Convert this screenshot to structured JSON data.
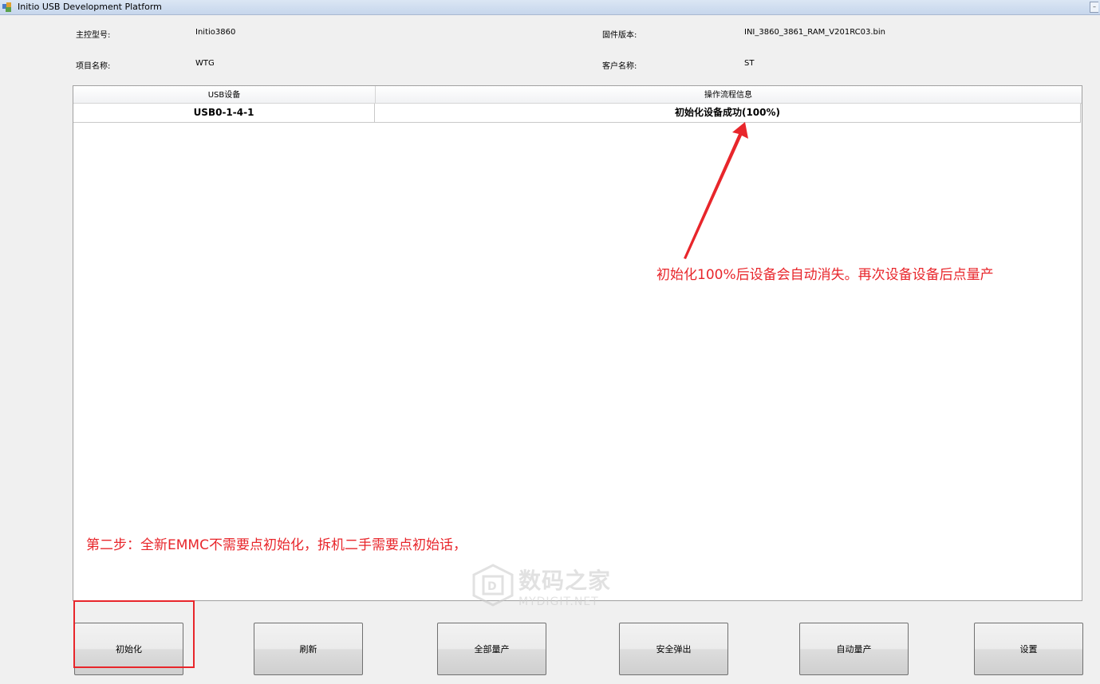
{
  "window": {
    "title": "Initio USB Development Platform"
  },
  "info": {
    "controller_label": "主控型号:",
    "controller_value": "Initio3860",
    "firmware_label": "固件版本:",
    "firmware_value": "INI_3860_3861_RAM_V201RC03.bin",
    "project_label": "项目名称:",
    "project_value": "WTG",
    "customer_label": "客户名称:",
    "customer_value": "ST"
  },
  "table": {
    "headers": [
      "USB设备",
      "操作流程信息"
    ],
    "rows": [
      {
        "device": "USB0-1-4-1",
        "status": "初始化设备成功(100%)"
      }
    ]
  },
  "annotations": {
    "arrow_note": "初始化100%后设备会自动消失。再次设备设备后点量产",
    "step_note": "第二步：全新EMMC不需要点初始化，拆机二手需要点初始话，",
    "color": "#e8262b"
  },
  "watermark": {
    "cn": "数码之家",
    "en": "MYDIGIT.NET"
  },
  "buttons": {
    "init": "初始化",
    "refresh": "刷新",
    "mass_all": "全部量产",
    "safe_eject": "安全弹出",
    "auto_mass": "自动量产",
    "settings": "设置"
  }
}
